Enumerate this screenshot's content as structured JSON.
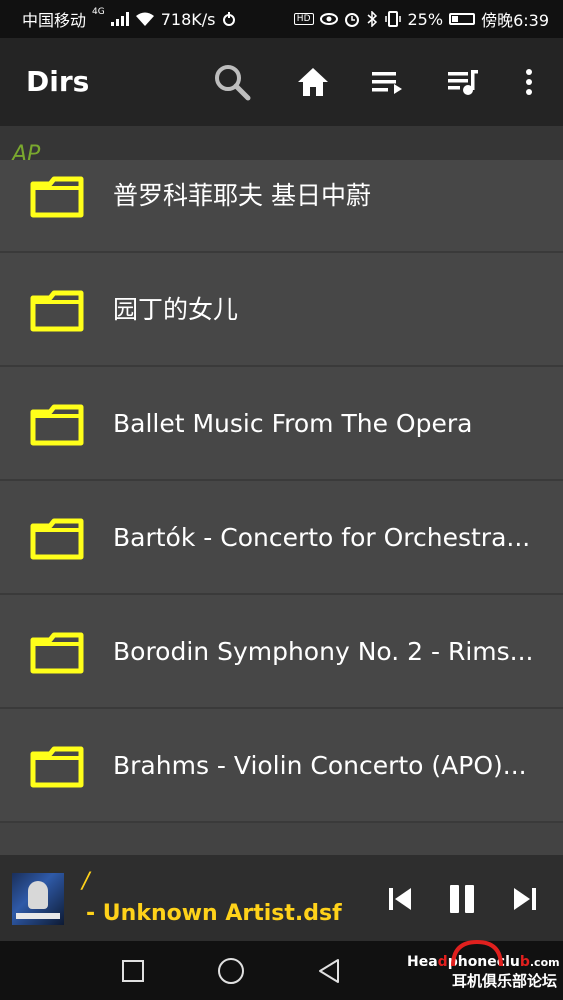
{
  "status_bar": {
    "carrier": "中国移动",
    "network": "4G",
    "speed": "718K/s",
    "battery": "25%",
    "time": "傍晚6:39",
    "hd_badge": "HD"
  },
  "toolbar": {
    "title": "Dirs",
    "icons": [
      "search-icon",
      "home-icon",
      "queue-play-icon",
      "playlist-music-icon",
      "overflow-menu-icon"
    ]
  },
  "path": {
    "current": "AP"
  },
  "folders": [
    {
      "label": "普罗科菲耶夫 基日中蔚"
    },
    {
      "label": "园丁的女儿"
    },
    {
      "label": "Ballet Music From The Opera"
    },
    {
      "label": "Bartók - Concerto for Orchestra..."
    },
    {
      "label": "Borodin Symphony No. 2 - Rims..."
    },
    {
      "label": "Brahms - Violin Concerto (APO)..."
    }
  ],
  "now_playing": {
    "path": "/",
    "track": "- Unknown Artist.dsf"
  },
  "colors": {
    "accent_yellow": "#ffd21a",
    "folder_yellow": "#ffff1a",
    "path_green": "#7aa82e",
    "toolbar_bg": "#242424",
    "list_bg": "#474747"
  },
  "watermark": {
    "line1_a": "Hea",
    "line1_b": "d",
    "line1_c": "phoneclu",
    "line1_d": "b",
    "line1_e": ".com",
    "line2": "耳机俱乐部论坛"
  }
}
